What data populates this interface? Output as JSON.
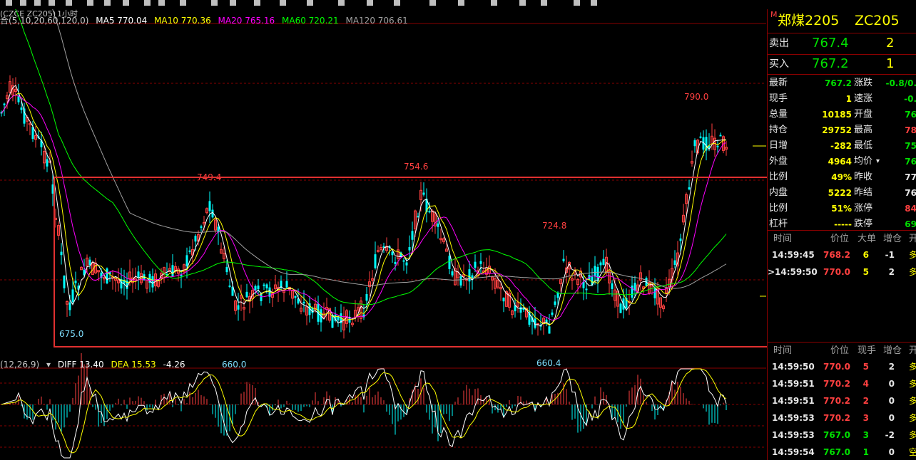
{
  "toolbar_hint": "toolbar icons (cropped)",
  "chart_header": {
    "indicator": "(CZCE ZC205)",
    "ma_params": "合(5,10,20,60,120,0)",
    "period": "1小时",
    "ma5": "MA5 770.04",
    "ma10": "MA10 770.36",
    "ma20": "MA20 765.16",
    "ma60": "MA60 720.21",
    "ma120": "MA120 706.61"
  },
  "macd_header": {
    "params": "(12,26,9)",
    "diff": "DIFF 13.40",
    "dea": "DEA 15.53",
    "macd": "-4.26"
  },
  "annotations": {
    "high_790": "790.0",
    "p749": "749.4",
    "p754": "754.6",
    "p724": "724.8",
    "low_675": "675.0",
    "low_660": "660.0",
    "low_6604": "660.4"
  },
  "colors": {
    "up": "#ff4040",
    "down": "#00ffff",
    "ma5": "#ffffff",
    "ma10": "#ffff00",
    "ma20": "#ff00ff",
    "ma60": "#00ff00",
    "ma120": "#a0a0a0",
    "highlight_box": "#e03030"
  },
  "panel": {
    "marker": "M",
    "name": "郑煤2205",
    "code": "ZC205",
    "ask_label": "卖出",
    "ask_price": "767.4",
    "ask_vol": "2",
    "bid_label": "买入",
    "bid_price": "767.2",
    "bid_vol": "1",
    "stats": [
      {
        "l1": "最新",
        "v1": "767.2",
        "c1": "green",
        "l2": "涨跌",
        "v2": "-0.8/0.",
        "c2": "green"
      },
      {
        "l1": "现手",
        "v1": "1",
        "c1": "yellow",
        "l2": "速涨",
        "v2": "-0.",
        "c2": "green"
      },
      {
        "l1": "总量",
        "v1": "10185",
        "c1": "yellow",
        "l2": "开盘",
        "v2": "76",
        "c2": "green"
      },
      {
        "l1": "持仓",
        "v1": "29752",
        "c1": "yellow",
        "l2": "最高",
        "v2": "78",
        "c2": "red"
      },
      {
        "l1": "日增",
        "v1": "-282",
        "c1": "yellow",
        "l2": "最低",
        "v2": "75",
        "c2": "green"
      },
      {
        "l1": "外盘",
        "v1": "4964",
        "c1": "yellow",
        "l2": "均价",
        "v2": "76",
        "c2": "green"
      },
      {
        "l1": "比例",
        "v1": "49%",
        "c1": "yellow",
        "l2": "昨收",
        "v2": "77",
        "c2": "white"
      },
      {
        "l1": "内盘",
        "v1": "5222",
        "c1": "yellow",
        "l2": "昨结",
        "v2": "76",
        "c2": "white"
      },
      {
        "l1": "比例",
        "v1": "51%",
        "c1": "yellow",
        "l2": "涨停",
        "v2": "84",
        "c2": "red"
      },
      {
        "l1": "杠杆",
        "v1": "-----",
        "c1": "yellow",
        "l2": "跌停",
        "v2": "69",
        "c2": "green"
      }
    ],
    "big_header": {
      "time": "时间",
      "price": "价位",
      "vol": "大单",
      "oi": "增仓",
      "kind": "开"
    },
    "big_orders": [
      {
        "prefix": "",
        "time": "14:59:45",
        "price": "768.2",
        "vol": "6",
        "oi": "-1",
        "kind": "多"
      },
      {
        "prefix": ">",
        "time": "14:59:50",
        "price": "770.0",
        "vol": "5",
        "oi": "2",
        "kind": "多"
      }
    ],
    "tick_header": {
      "time": "时间",
      "price": "价位",
      "vol": "现手",
      "oi": "增仓",
      "kind": "开"
    },
    "ticks": [
      {
        "time": "14:59:50",
        "price": "770.0",
        "pc": "red",
        "vol": "5",
        "vc": "red",
        "oi": "2",
        "kind": "多"
      },
      {
        "time": "14:59:51",
        "price": "770.2",
        "pc": "red",
        "vol": "4",
        "vc": "red",
        "oi": "0",
        "kind": "多"
      },
      {
        "time": "14:59:51",
        "price": "770.2",
        "pc": "red",
        "vol": "2",
        "vc": "red",
        "oi": "0",
        "kind": "多"
      },
      {
        "time": "14:59:53",
        "price": "770.2",
        "pc": "red",
        "vol": "3",
        "vc": "red",
        "oi": "0",
        "kind": "多"
      },
      {
        "time": "14:59:53",
        "price": "767.0",
        "pc": "green",
        "vol": "3",
        "vc": "green",
        "oi": "-2",
        "kind": "多"
      },
      {
        "time": "14:59:54",
        "price": "767.0",
        "pc": "green",
        "vol": "1",
        "vc": "green",
        "oi": "0",
        "kind": "空"
      }
    ]
  }
}
